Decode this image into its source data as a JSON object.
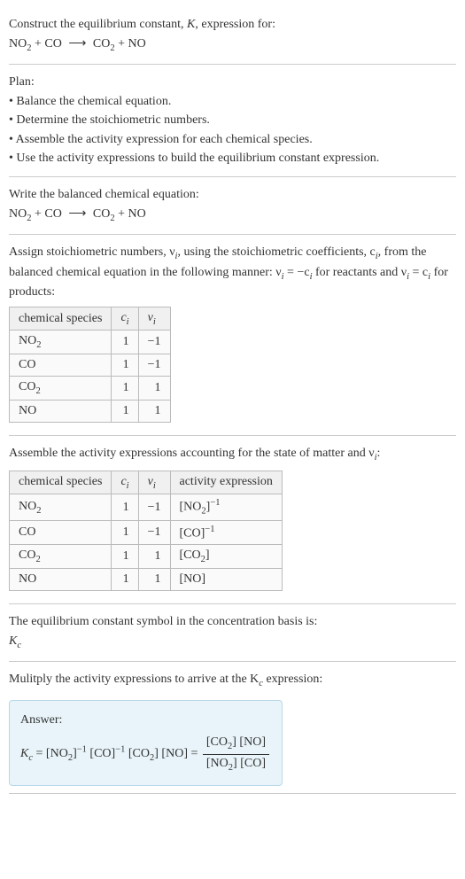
{
  "intro": {
    "line1": "Construct the equilibrium constant, K, expression for:",
    "equation_reactant1": "NO",
    "equation_reactant1_sub": "2",
    "plus": " + ",
    "equation_reactant2": "CO",
    "arrow": "⟶",
    "equation_product1": "CO",
    "equation_product1_sub": "2",
    "equation_product2": "NO"
  },
  "plan": {
    "heading": "Plan:",
    "b1": "• Balance the chemical equation.",
    "b2": "• Determine the stoichiometric numbers.",
    "b3": "• Assemble the activity expression for each chemical species.",
    "b4": "• Use the activity expressions to build the equilibrium constant expression."
  },
  "balanced": {
    "heading": "Write the balanced chemical equation:"
  },
  "stoich": {
    "text1": "Assign stoichiometric numbers, ν",
    "text1_sub": "i",
    "text2": ", using the stoichiometric coefficients, c",
    "text2_sub": "i",
    "text3": ", from the balanced chemical equation in the following manner: ν",
    "text3_sub": "i",
    "text4": " = −c",
    "text4_sub": "i",
    "text5": " for reactants and ν",
    "text5_sub": "i",
    "text6": " = c",
    "text6_sub": "i",
    "text7": " for products:",
    "headers": {
      "species": "chemical species",
      "ci": "c",
      "ci_sub": "i",
      "vi": "ν",
      "vi_sub": "i"
    },
    "rows": [
      {
        "species_pre": "NO",
        "species_sub": "2",
        "species_post": "",
        "c": "1",
        "v": "−1"
      },
      {
        "species_pre": "CO",
        "species_sub": "",
        "species_post": "",
        "c": "1",
        "v": "−1"
      },
      {
        "species_pre": "CO",
        "species_sub": "2",
        "species_post": "",
        "c": "1",
        "v": "1"
      },
      {
        "species_pre": "NO",
        "species_sub": "",
        "species_post": "",
        "c": "1",
        "v": "1"
      }
    ]
  },
  "activity": {
    "heading_pre": "Assemble the activity expressions accounting for the state of matter and ν",
    "heading_sub": "i",
    "heading_post": ":",
    "headers": {
      "species": "chemical species",
      "ci": "c",
      "ci_sub": "i",
      "vi": "ν",
      "vi_sub": "i",
      "act": "activity expression"
    },
    "rows": [
      {
        "sp_pre": "NO",
        "sp_sub": "2",
        "c": "1",
        "v": "−1",
        "act_open": "[NO",
        "act_sub": "2",
        "act_close": "]",
        "act_sup": "−1"
      },
      {
        "sp_pre": "CO",
        "sp_sub": "",
        "c": "1",
        "v": "−1",
        "act_open": "[CO",
        "act_sub": "",
        "act_close": "]",
        "act_sup": "−1"
      },
      {
        "sp_pre": "CO",
        "sp_sub": "2",
        "c": "1",
        "v": "1",
        "act_open": "[CO",
        "act_sub": "2",
        "act_close": "]",
        "act_sup": ""
      },
      {
        "sp_pre": "NO",
        "sp_sub": "",
        "c": "1",
        "v": "1",
        "act_open": "[NO",
        "act_sub": "",
        "act_close": "]",
        "act_sup": ""
      }
    ]
  },
  "symbol": {
    "line1": "The equilibrium constant symbol in the concentration basis is:",
    "k": "K",
    "k_sub": "c"
  },
  "final": {
    "heading_pre": "Mulitply the activity expressions to arrive at the K",
    "heading_sub": "c",
    "heading_post": " expression:",
    "answer_label": "Answer:",
    "k": "K",
    "k_sub": "c",
    "eq": " = ",
    "t1_open": "[NO",
    "t1_sub": "2",
    "t1_close": "]",
    "t1_sup": "−1",
    "t2_open": " [CO",
    "t2_close": "]",
    "t2_sup": "−1",
    "t3_open": " [CO",
    "t3_sub": "2",
    "t3_close": "]",
    "t4_open": " [NO",
    "t4_close": "] = ",
    "num_a_open": "[CO",
    "num_a_sub": "2",
    "num_a_close": "] ",
    "num_b_open": "[NO",
    "num_b_close": "]",
    "den_a_open": "[NO",
    "den_a_sub": "2",
    "den_a_close": "] ",
    "den_b_open": "[CO",
    "den_b_close": "]"
  }
}
